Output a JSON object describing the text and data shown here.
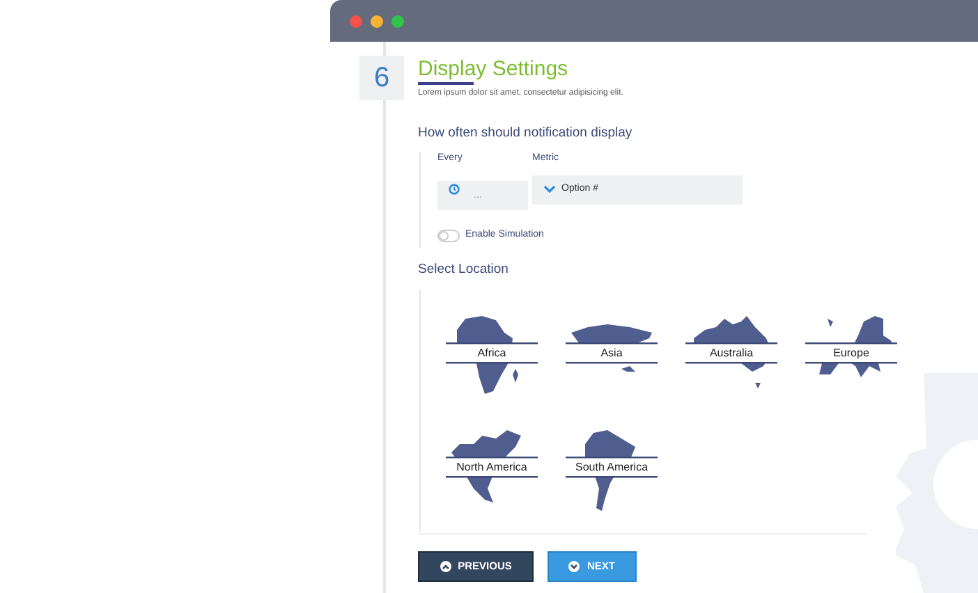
{
  "step": {
    "number": "6",
    "title": "Display Settings",
    "subtitle": "Lorem ipsum dolor sit amet, consectetur adipisicing elit."
  },
  "frequency": {
    "heading": "How often should notification display",
    "every": {
      "label": "Every",
      "placeholder": "..."
    },
    "metric": {
      "label": "Metric",
      "value": "Option #"
    }
  },
  "enable_simulation": {
    "label": "Enable Simulation",
    "on": false
  },
  "location": {
    "heading": "Select Location",
    "items": [
      {
        "label": "Africa",
        "kind": "africa"
      },
      {
        "label": "Asia",
        "kind": "asia"
      },
      {
        "label": "Australia",
        "kind": "australia"
      },
      {
        "label": "Europe",
        "kind": "europe"
      },
      {
        "label": "North America",
        "kind": "north_america"
      },
      {
        "label": "South America",
        "kind": "south_america"
      }
    ]
  },
  "buttons": [
    {
      "label": "PREVIOUS",
      "kind": "previous"
    },
    {
      "label": "NEXT",
      "kind": "next"
    }
  ]
}
